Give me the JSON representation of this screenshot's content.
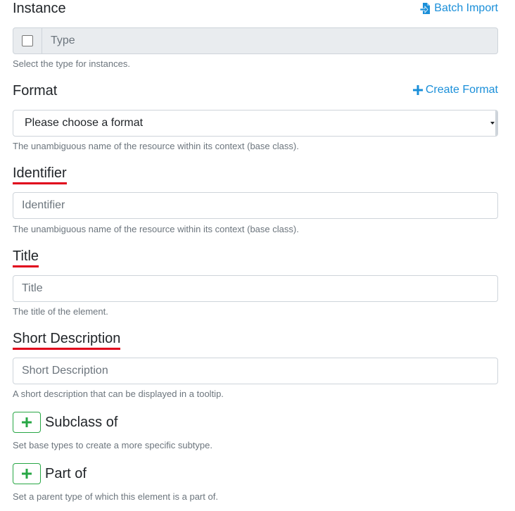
{
  "instance": {
    "heading": "Instance",
    "batch_import_label": "Batch Import",
    "type_placeholder": "Type",
    "help": "Select the type for instances."
  },
  "format": {
    "heading": "Format",
    "create_label": "Create Format",
    "selected": "Please choose a format",
    "help": "The unambiguous name of the resource within its context (base class)."
  },
  "identifier": {
    "heading": "Identifier",
    "placeholder": "Identifier",
    "help": "The unambiguous name of the resource within its context (base class)."
  },
  "title": {
    "heading": "Title",
    "placeholder": "Title",
    "help": "The title of the element."
  },
  "short_description": {
    "heading": "Short Description",
    "placeholder": "Short Description",
    "help": "A short description that can be displayed in a tooltip."
  },
  "subclass_of": {
    "label": "Subclass of",
    "help": "Set base types to create a more specific subtype."
  },
  "part_of": {
    "label": "Part of",
    "help": "Set a parent type of which this element is a part of."
  },
  "colors": {
    "link": "#1a8fd9",
    "required_underline": "#e0001b",
    "add_button": "#28a745"
  }
}
